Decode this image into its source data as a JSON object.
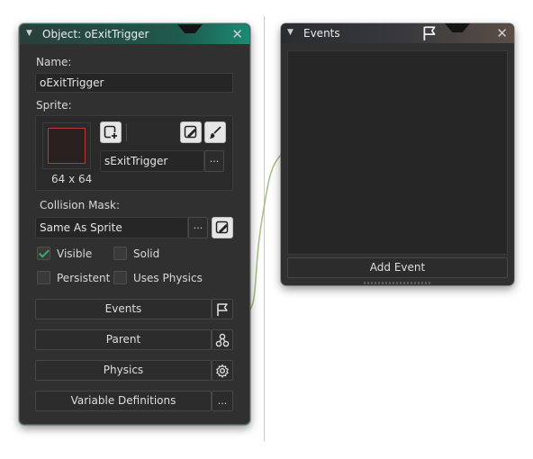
{
  "object_window": {
    "title": "Object: oExitTrigger",
    "name_label": "Name:",
    "name_value": "oExitTrigger",
    "sprite_label": "Sprite:",
    "sprite_size": "64 x 64",
    "sprite_name": "sExitTrigger",
    "collision_label": "Collision Mask:",
    "collision_value": "Same As Sprite",
    "ellipsis": "...",
    "checkboxes": {
      "visible": {
        "label": "Visible",
        "checked": true
      },
      "solid": {
        "label": "Solid",
        "checked": false
      },
      "persistent": {
        "label": "Persistent",
        "checked": false
      },
      "uses_physics": {
        "label": "Uses Physics",
        "checked": false
      }
    },
    "buttons": {
      "events": "Events",
      "parent": "Parent",
      "physics": "Physics",
      "variable_definitions": "Variable Definitions"
    }
  },
  "events_window": {
    "title": "Events",
    "add_event": "Add Event"
  },
  "icons": {
    "collapse": "triangle-down-icon",
    "close": "close-icon",
    "new_sprite": "new-sprite-icon",
    "edit_sprite": "edit-image-icon",
    "brush": "brush-icon",
    "flag": "flag-icon",
    "parent": "parent-nodes-icon",
    "physics": "gear-icon"
  },
  "colors": {
    "window_bg": "#303030",
    "object_titlebar_accent": "#1b8a72",
    "check_green": "#3fa96a",
    "sprite_border": "#b23a3a"
  }
}
